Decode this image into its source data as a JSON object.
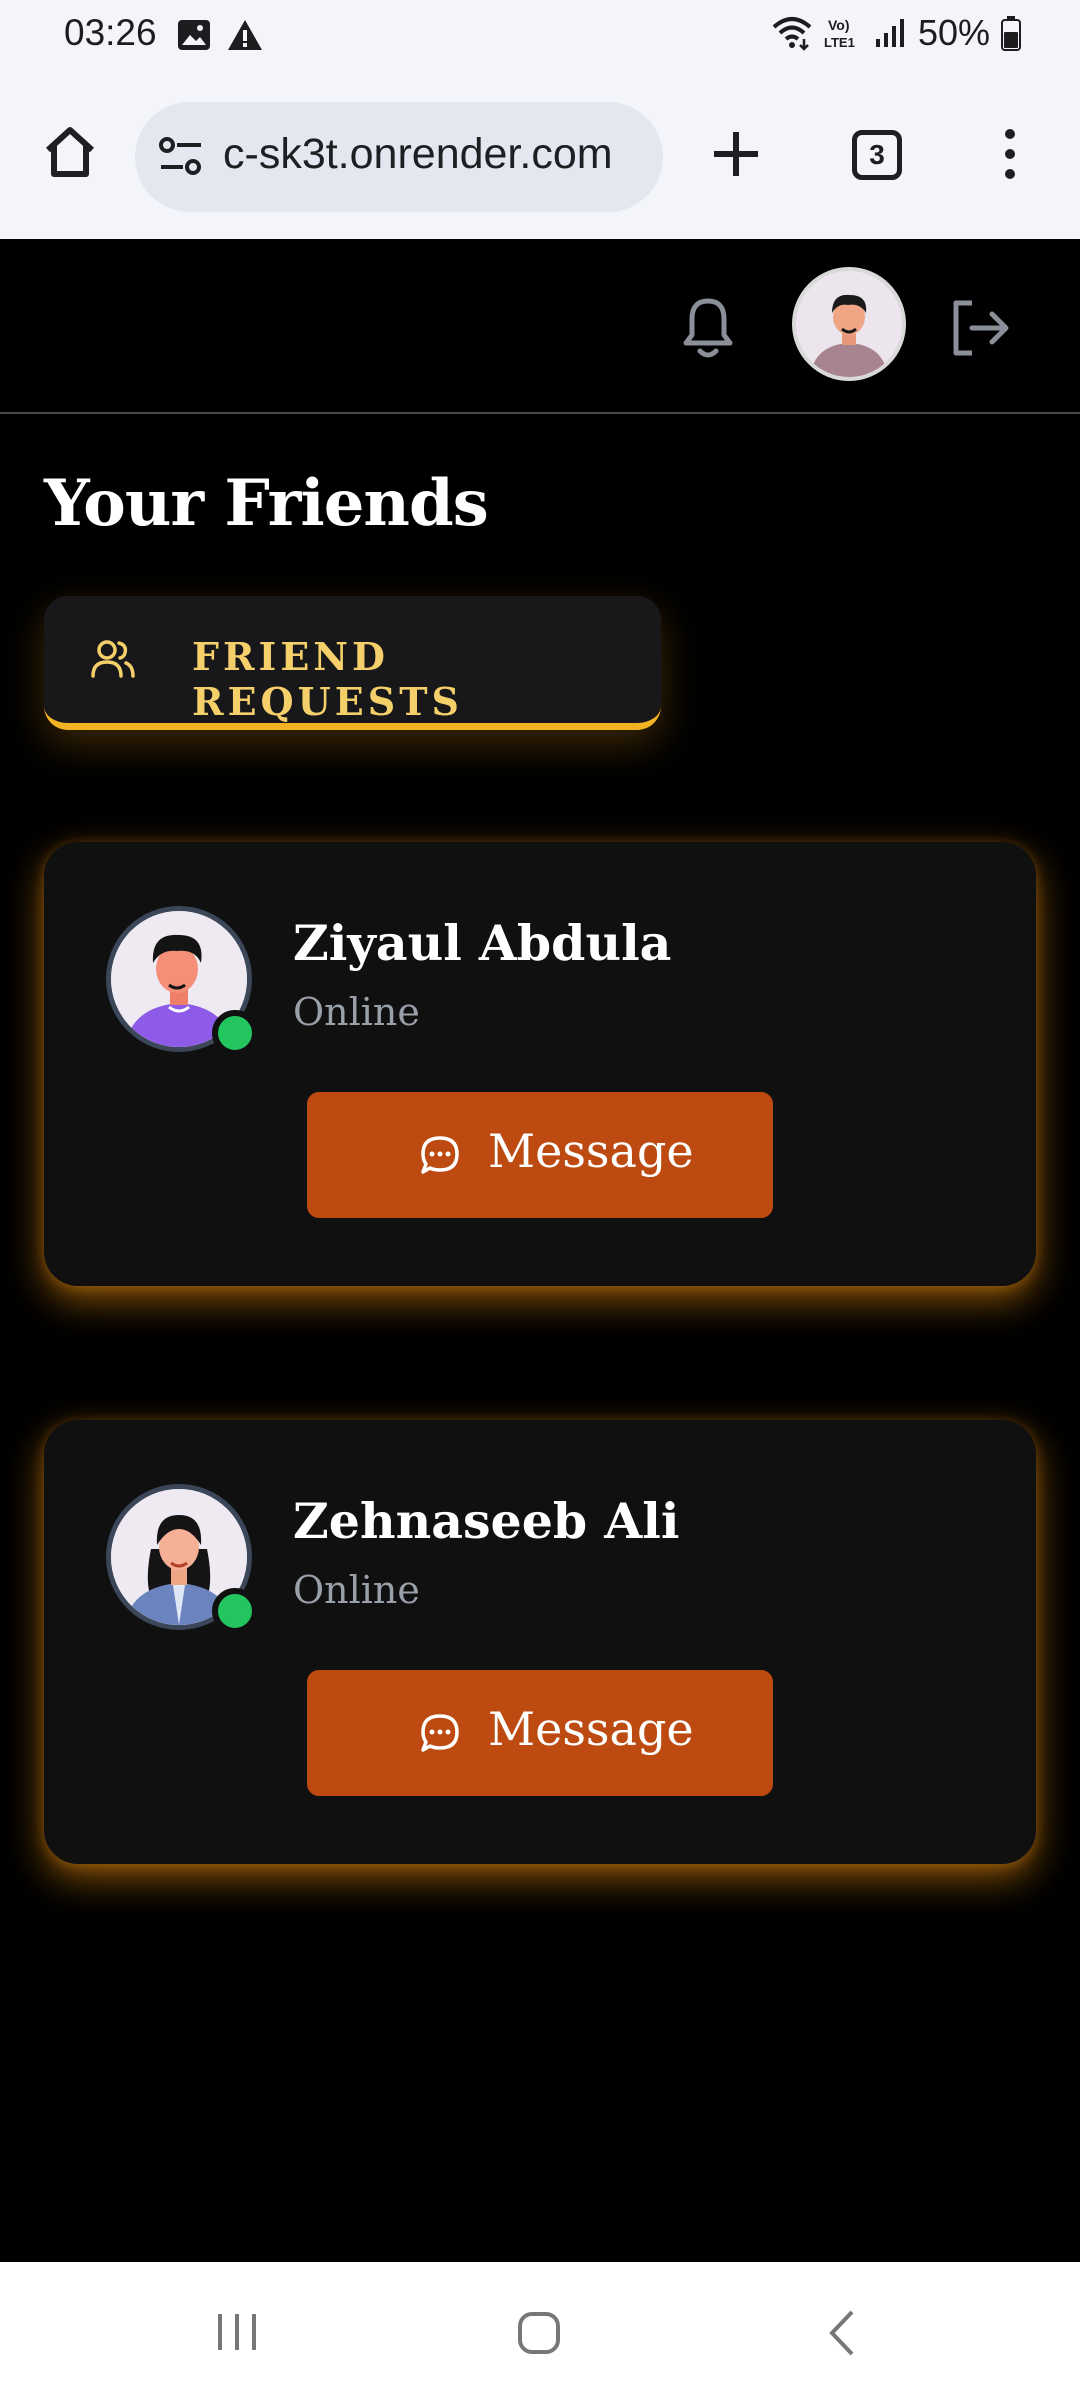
{
  "status_bar": {
    "time": "03:26",
    "battery_percent": "50%",
    "icons": [
      "image-icon",
      "warning-icon",
      "wifi-icon",
      "volte-icon",
      "signal-icon",
      "battery-icon"
    ]
  },
  "browser": {
    "url": "c-sk3t.onrender.com",
    "tab_count": "3"
  },
  "app_header": {
    "icons": [
      "bell-icon",
      "user-avatar",
      "logout-icon"
    ]
  },
  "main": {
    "title": "Your Friends",
    "friend_requests_label": "FRIEND REQUESTS"
  },
  "friends": [
    {
      "name": "Ziyaul Abdula",
      "status": "Online",
      "message_label": "Message"
    },
    {
      "name": "Zehnaseeb Ali",
      "status": "Online",
      "message_label": "Message"
    }
  ],
  "colors": {
    "background": "#000000",
    "card": "#101010",
    "accent_gold": "#f2b323",
    "message_button": "#bd4a10",
    "online": "#22c55e",
    "card_glow": "#f5960f"
  }
}
